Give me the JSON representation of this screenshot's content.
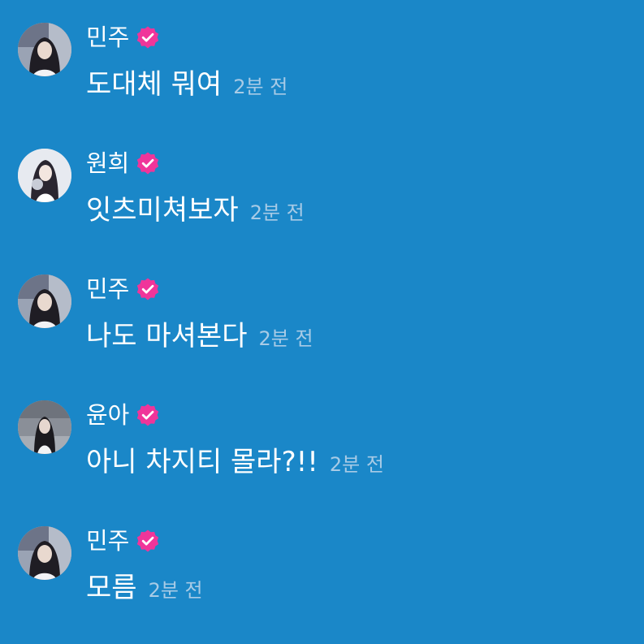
{
  "colors": {
    "background": "#1a87c8",
    "text": "#ffffff",
    "timestamp": "#a8cbe6",
    "badge": "#f0359a"
  },
  "messages": [
    {
      "author": "민주",
      "badge_icon": "verified-check-icon",
      "text": "도대체 뭐여",
      "time": "2분 전"
    },
    {
      "author": "원희",
      "badge_icon": "verified-check-icon",
      "text": "잇츠미쳐보자",
      "time": "2분 전"
    },
    {
      "author": "민주",
      "badge_icon": "verified-check-icon",
      "text": "나도 마셔본다",
      "time": "2분 전"
    },
    {
      "author": "윤아",
      "badge_icon": "verified-check-icon",
      "text": "아니 차지티 몰라?!!",
      "time": "2분 전"
    },
    {
      "author": "민주",
      "badge_icon": "verified-check-icon",
      "text": "모름",
      "time": "2분 전"
    }
  ]
}
